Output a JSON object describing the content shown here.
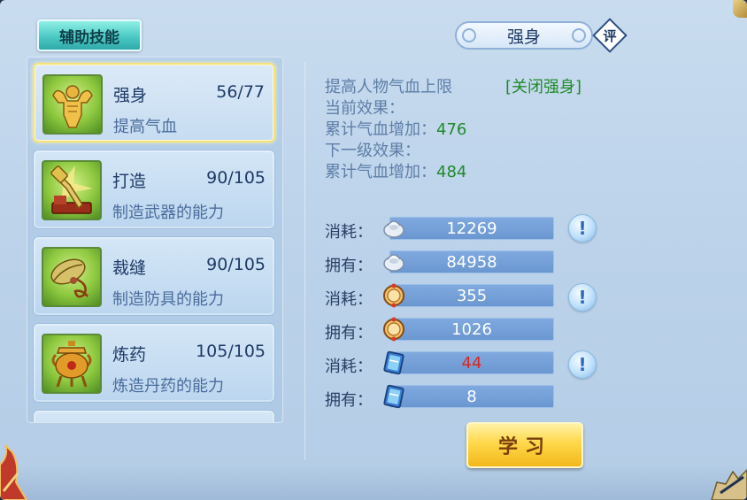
{
  "tab": {
    "label": "辅助技能"
  },
  "title": "强身",
  "rate_badge": "评",
  "skills": [
    {
      "name": "强身",
      "level": "56/77",
      "desc": "提高气血",
      "icon": "strongman-icon",
      "selected": true
    },
    {
      "name": "打造",
      "level": "90/105",
      "desc": "制造武器的能力",
      "icon": "hammer-icon",
      "selected": false
    },
    {
      "name": "裁缝",
      "level": "90/105",
      "desc": "制造防具的能力",
      "icon": "sewing-icon",
      "selected": false
    },
    {
      "name": "炼药",
      "level": "105/105",
      "desc": "炼造丹药的能力",
      "icon": "cauldron-icon",
      "selected": false
    }
  ],
  "effect": {
    "description": "提高人物气血上限",
    "close_label": "[关闭强身]",
    "current_label": "当前效果：",
    "current_stat_label": "累计气血增加：",
    "current_value": "476",
    "next_label": "下一级效果：",
    "next_stat_label": "累计气血增加：",
    "next_value": "484"
  },
  "costs": [
    {
      "label": "消耗：",
      "value": "12269",
      "icon": "silver-icon",
      "red": false
    },
    {
      "label": "拥有：",
      "value": "84958",
      "icon": "silver-icon",
      "red": false
    },
    {
      "label": "消耗：",
      "value": "355",
      "icon": "contribution-icon",
      "red": false
    },
    {
      "label": "拥有：",
      "value": "1026",
      "icon": "contribution-icon",
      "red": false
    },
    {
      "label": "消耗：",
      "value": "44",
      "icon": "book-icon",
      "red": true
    },
    {
      "label": "拥有：",
      "value": "8",
      "icon": "book-icon",
      "red": false
    }
  ],
  "info_symbol": "!",
  "learn_button": "学习",
  "colors": {
    "accent_green": "#1f8a2a",
    "insufficient_red": "#e0241c",
    "selected_border": "#f6e27a"
  }
}
